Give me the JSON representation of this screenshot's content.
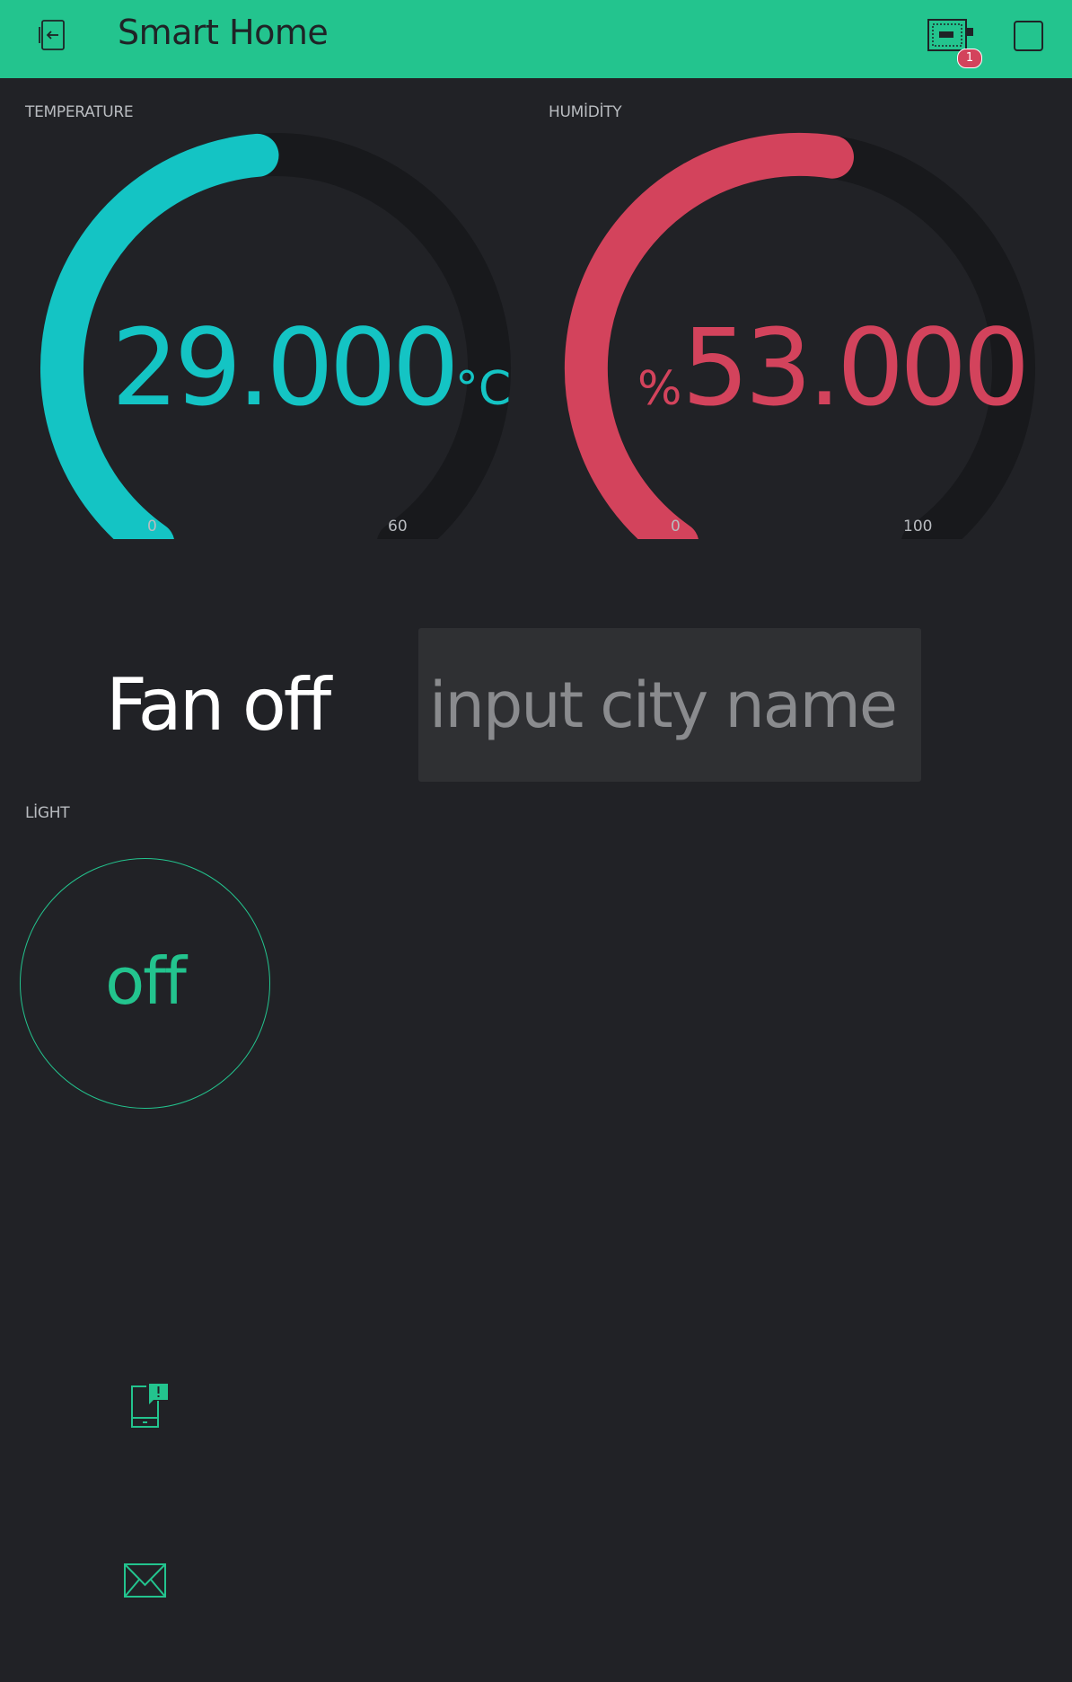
{
  "header": {
    "title": "Smart Home",
    "notification_count": "1"
  },
  "icons": {
    "back": "exit-project-icon",
    "device": "device-board-icon",
    "square": "square-icon",
    "notification": "phone-notification-icon",
    "email": "email-icon"
  },
  "colors": {
    "accent": "#23c48e",
    "temperature": "#14c4c4",
    "humidity": "#d3435c",
    "track": "#18191c",
    "background": "#212226"
  },
  "temperature": {
    "label": "TEMPERATURE",
    "value": "29.000",
    "unit": "°C",
    "min": "0",
    "max": "60",
    "level": 0.483
  },
  "humidity": {
    "label": "HUMİDİTY",
    "value": "53.000",
    "unit": "%",
    "min": "0",
    "max": "100",
    "level": 0.53
  },
  "fan": {
    "label": "Fan off"
  },
  "city": {
    "placeholder": "input city name",
    "value": ""
  },
  "light": {
    "label": "LİGHT",
    "button_text": "off"
  }
}
